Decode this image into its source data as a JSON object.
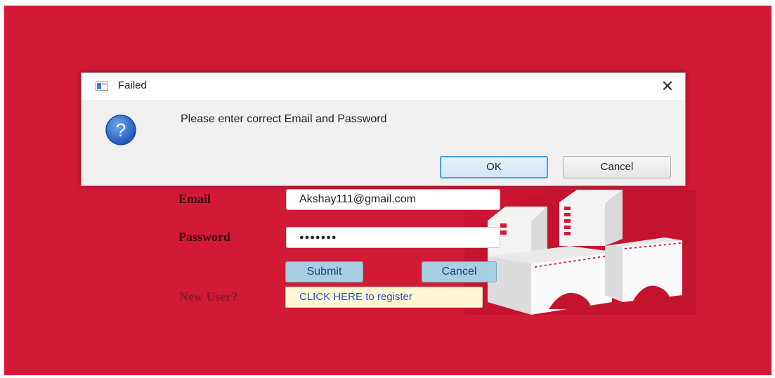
{
  "form": {
    "email_label": "Email",
    "email_value": "Akshay111@gmail.com",
    "password_label": "Password",
    "password_masked": "●●●●●●●",
    "submit_label": "Submit",
    "cancel_label": "Cancel",
    "new_user_label": "New User?",
    "register_link": "CLICK HERE to register"
  },
  "dialog": {
    "title": "Failed",
    "close_symbol": "✕",
    "message": "Please enter correct Email and Password",
    "ok_label": "OK",
    "cancel_label": "Cancel",
    "icon": "question-icon"
  },
  "colors": {
    "background": "#d21a37",
    "button_blue": "#a6cfe1",
    "dialog_bg": "#f0f0f0",
    "ok_border": "#4c9be0"
  }
}
